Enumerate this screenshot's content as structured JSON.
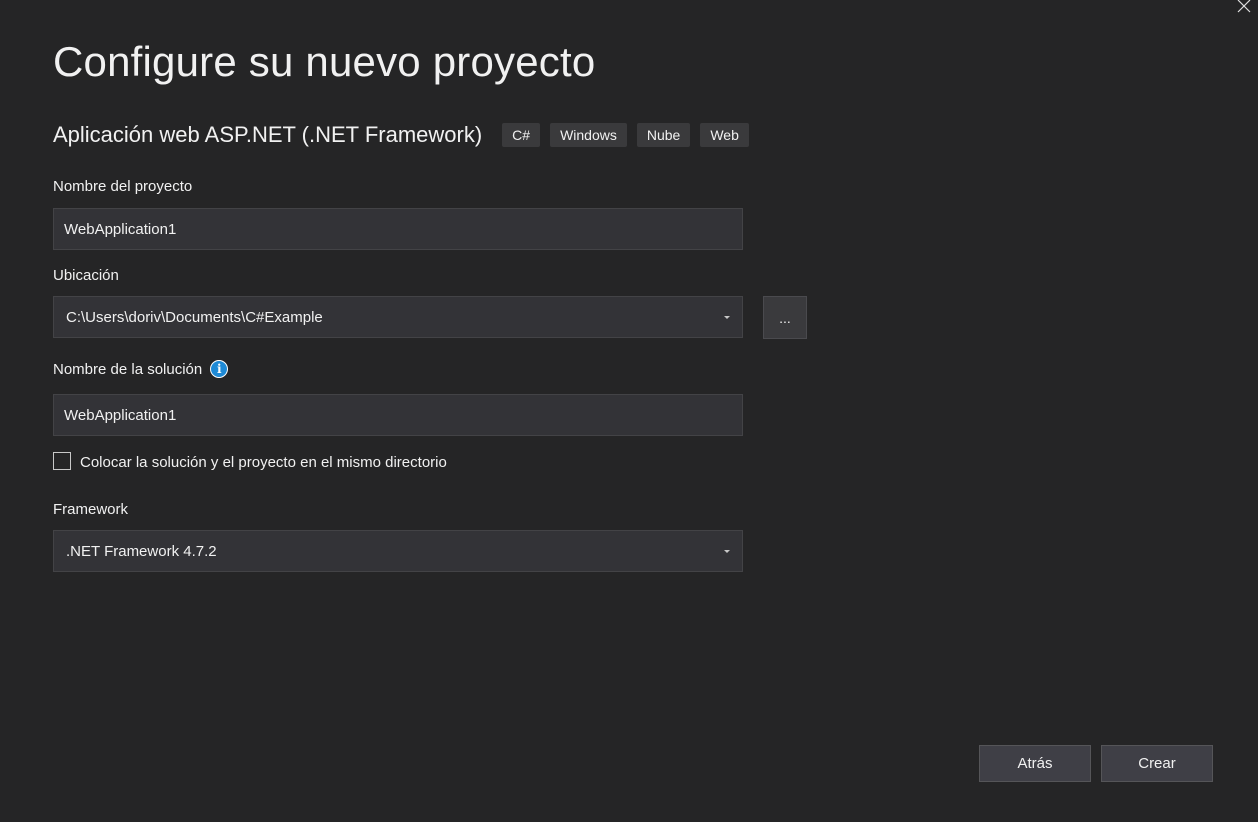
{
  "window": {
    "close_glyph": "✕"
  },
  "header": {
    "title": "Configure su nuevo proyecto"
  },
  "template": {
    "name": "Aplicación web ASP.NET (.NET Framework)",
    "tags": [
      "C#",
      "Windows",
      "Nube",
      "Web"
    ]
  },
  "project_name": {
    "label": "Nombre del proyecto",
    "value": "WebApplication1"
  },
  "location": {
    "label": "Ubicación",
    "value": "C:\\Users\\doriv\\Documents\\C#Example",
    "browse_label": "..."
  },
  "solution_name": {
    "label": "Nombre de la solución",
    "info_glyph": "i",
    "value": "WebApplication1"
  },
  "same_directory": {
    "label": "Colocar la solución y el proyecto en el mismo directorio",
    "checked": false
  },
  "framework": {
    "label": "Framework",
    "value": ".NET Framework 4.7.2"
  },
  "footer": {
    "back_label": "Atrás",
    "create_label": "Crear"
  },
  "colors": {
    "background": "#252526",
    "input_background": "#333337",
    "info_icon": "#1e8ad6",
    "button_background": "#3f3f46"
  }
}
